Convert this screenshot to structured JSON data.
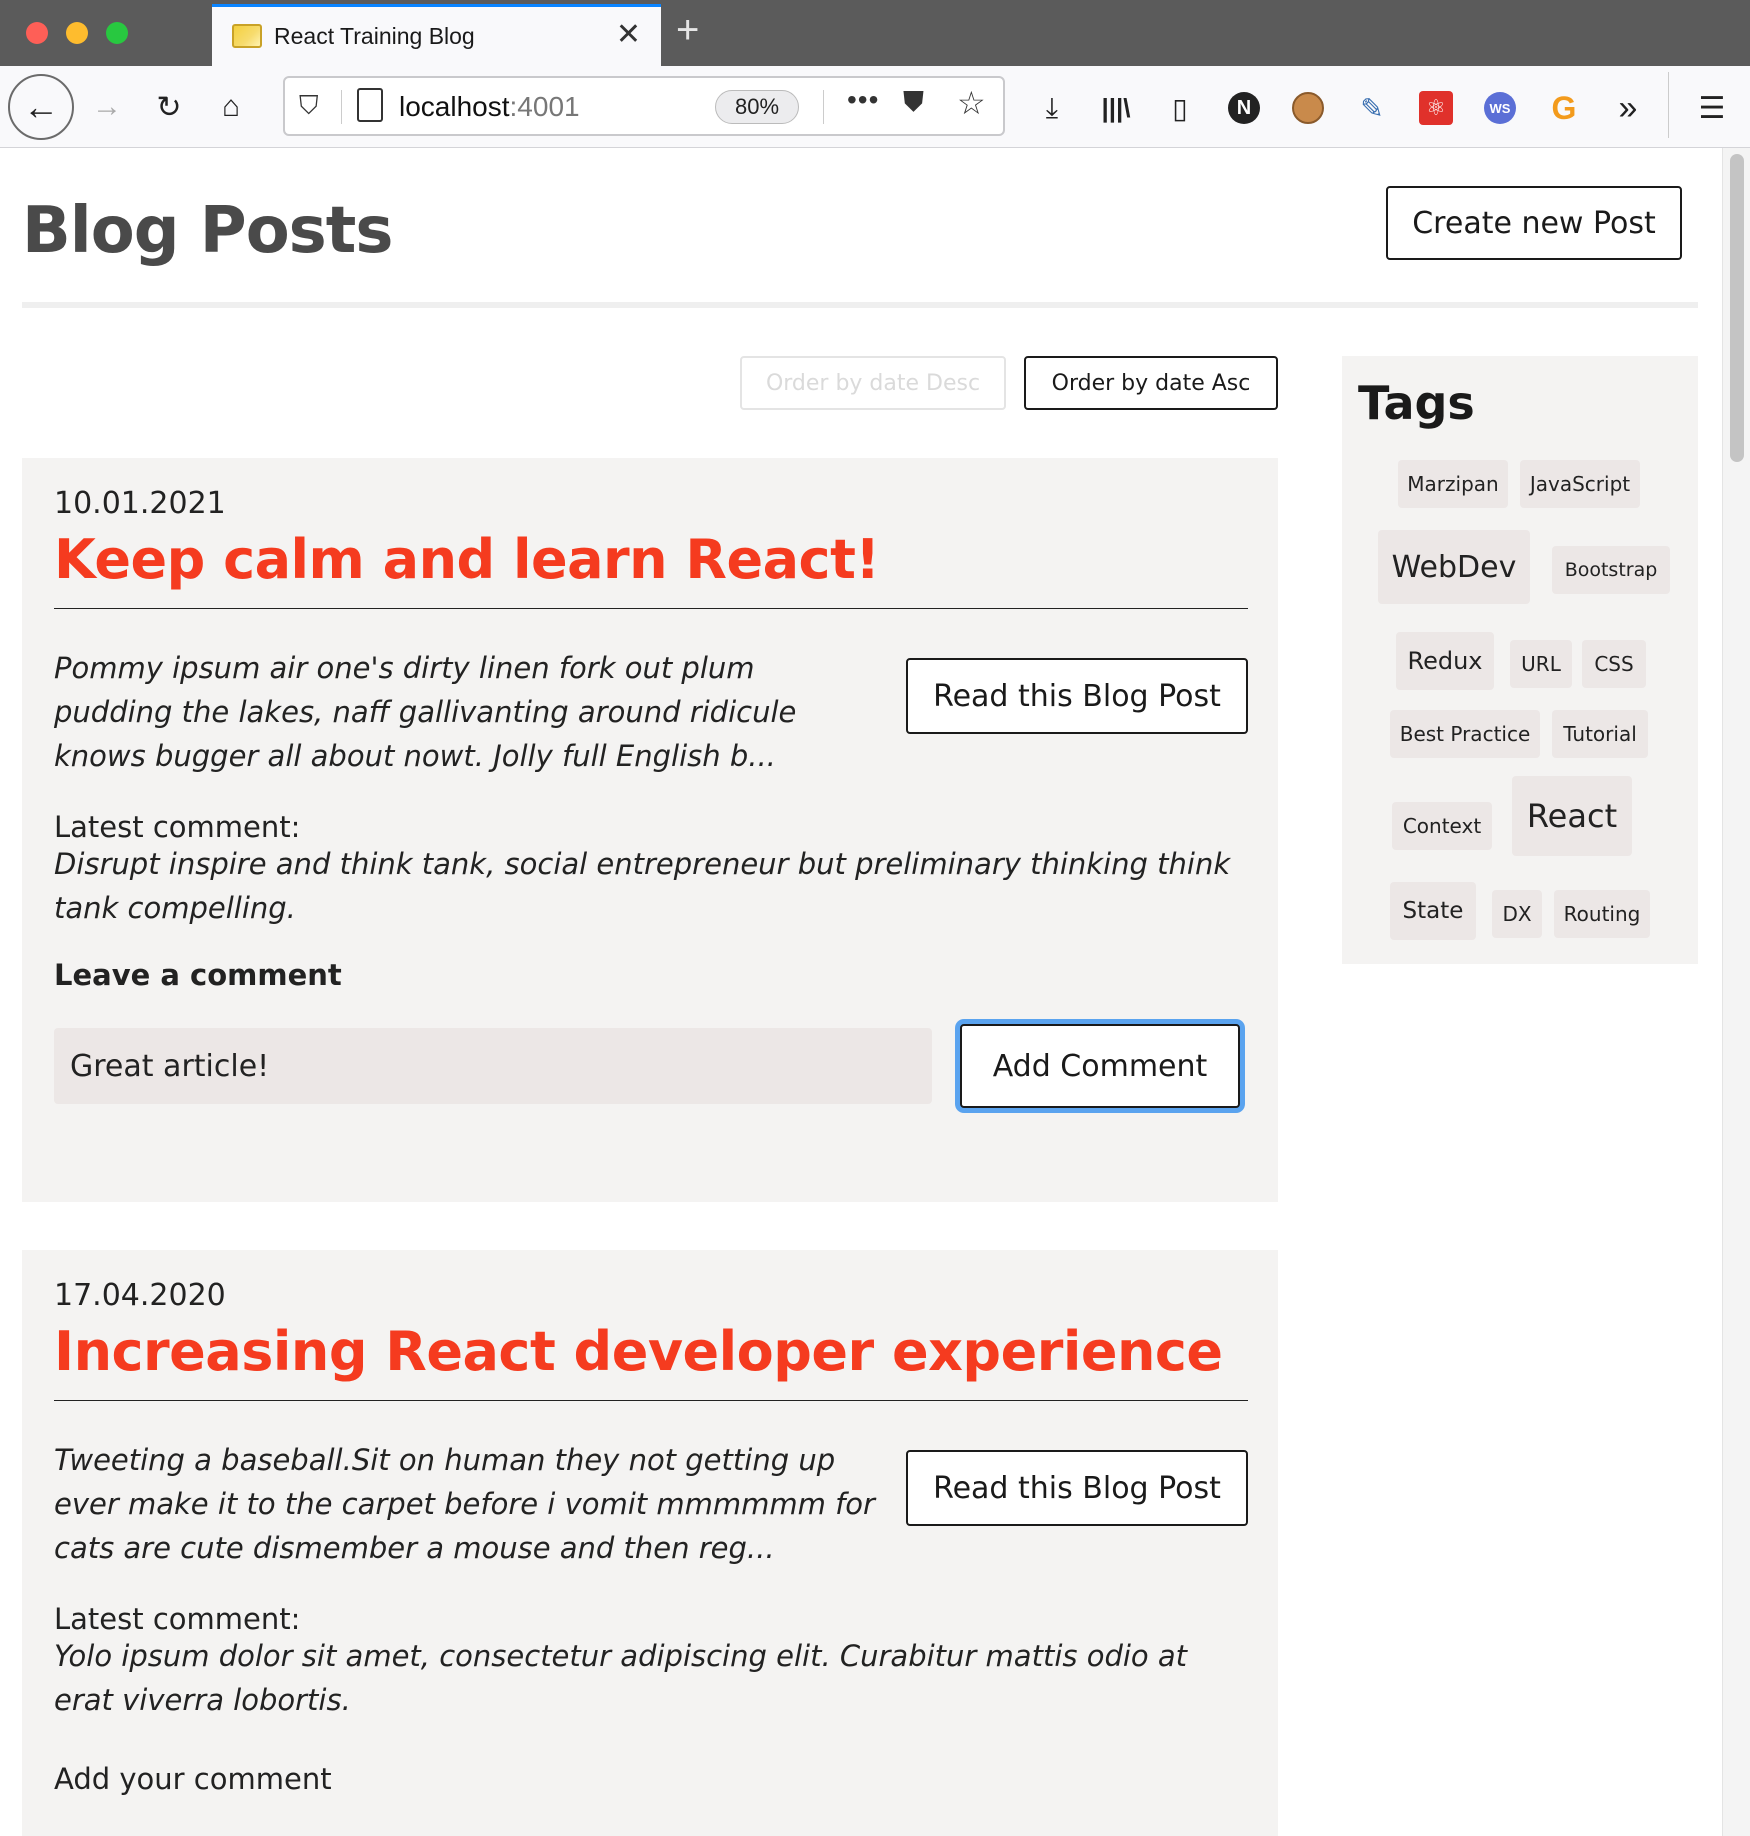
{
  "browser": {
    "tab_title": "React Training Blog",
    "url_host": "localhost",
    "url_port": ":4001",
    "zoom": "80%"
  },
  "header": {
    "title": "Blog Posts",
    "create_button": "Create new Post"
  },
  "sort": {
    "desc_label": "Order by date Desc",
    "asc_label": "Order by date Asc"
  },
  "posts": [
    {
      "date": "10.01.2021",
      "title": "Keep calm and learn React!",
      "excerpt": "Pommy ipsum air one's dirty linen fork out plum pudding the lakes, naff gallivanting around ridicule knows bugger all about nowt. Jolly full English b...",
      "read_button": "Read this Blog Post",
      "latest_comment_label": "Latest comment:",
      "latest_comment": "Disrupt inspire and think tank, social entrepreneur but preliminary thinking think tank compelling.",
      "leave_comment_label": "Leave a comment",
      "comment_value": "Great article!",
      "add_button": "Add Comment"
    },
    {
      "date": "17.04.2020",
      "title": "Increasing React developer experience",
      "excerpt": "Tweeting a baseball.Sit on human they not getting up ever make it to the carpet before i vomit mmmmmm for cats are cute dismember a mouse and then reg...",
      "read_button": "Read this Blog Post",
      "latest_comment_label": "Latest comment:",
      "latest_comment": "Yolo ipsum dolor sit amet, consectetur adipiscing elit. Curabitur mattis odio at erat viverra lobortis.",
      "add_comment_label": "Add your comment"
    }
  ],
  "tags": {
    "title": "Tags",
    "items": [
      "Marzipan",
      "JavaScript",
      "WebDev",
      "Bootstrap",
      "Redux",
      "URL",
      "CSS",
      "Best Practice",
      "Tutorial",
      "Context",
      "React",
      "State",
      "DX",
      "Routing"
    ]
  },
  "colors": {
    "accent_title": "#f53b1f",
    "card_bg": "#f4f3f2",
    "tag_bg": "#ece7e6",
    "focus_ring": "#5aa3ef"
  }
}
